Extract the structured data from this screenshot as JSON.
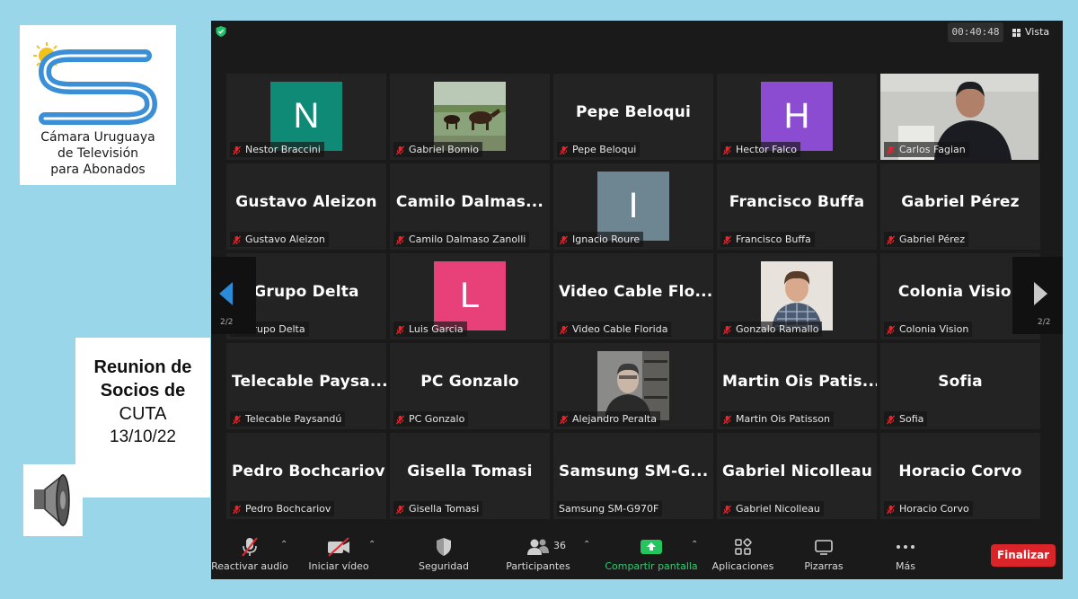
{
  "logo": {
    "line1": "Cámara Uruguaya",
    "line2": "de Televisión",
    "line3": "para Abonados",
    "colors": {
      "wave": "#3a8fd6",
      "sun": "#f2c21b"
    }
  },
  "note": {
    "line1": "Reunion de",
    "line2": "Socios de",
    "line3": "CUTA",
    "date": "13/10/22"
  },
  "zoom": {
    "timer": "00:40:48",
    "view_label": "Vista",
    "page_indicator_left": "2/2",
    "page_indicator_right": "2/2",
    "participants": [
      {
        "name": "Nestor Braccini",
        "big": "",
        "avatar_letter": "N",
        "avatar_color": "#0e8a76",
        "video": false
      },
      {
        "name": "Gabriel Bomio",
        "big": "",
        "avatar_letter": "",
        "avatar_color": "",
        "video": "horses"
      },
      {
        "name": "Pepe Beloqui",
        "big": "Pepe Beloqui",
        "avatar_letter": "",
        "avatar_color": "",
        "video": false
      },
      {
        "name": "Hector Falco",
        "big": "",
        "avatar_letter": "H",
        "avatar_color": "#8b4cd1",
        "video": false
      },
      {
        "name": "Carlos Fagian",
        "big": "",
        "avatar_letter": "",
        "avatar_color": "",
        "video": "man-room"
      },
      {
        "name": "Gustavo Aleizon",
        "big": "Gustavo Aleizon",
        "avatar_letter": "",
        "avatar_color": "",
        "video": false
      },
      {
        "name": "Camilo Dalmaso Zanolli",
        "big": "Camilo  Dalmas...",
        "avatar_letter": "",
        "avatar_color": "",
        "video": false
      },
      {
        "name": "Ignacio Roure",
        "big": "",
        "avatar_letter": "I",
        "avatar_color": "#6e8592",
        "video": false
      },
      {
        "name": "Francisco Buffa",
        "big": "Francisco Buffa",
        "avatar_letter": "",
        "avatar_color": "",
        "video": false
      },
      {
        "name": "Gabriel Pérez",
        "big": "Gabriel Pérez",
        "avatar_letter": "",
        "avatar_color": "",
        "video": false
      },
      {
        "name": "Grupo Delta",
        "big": "Grupo Delta",
        "avatar_letter": "",
        "avatar_color": "",
        "video": false
      },
      {
        "name": "Luis Garcia",
        "big": "",
        "avatar_letter": "L",
        "avatar_color": "#e84078",
        "video": false
      },
      {
        "name": "Video Cable Florida",
        "big": "Video  Cable  Flo...",
        "avatar_letter": "",
        "avatar_color": "",
        "video": false
      },
      {
        "name": "Gonzalo Ramallo",
        "big": "",
        "avatar_letter": "",
        "avatar_color": "",
        "video": "young-man"
      },
      {
        "name": "Colonia Vision",
        "big": "Colonia Vision",
        "avatar_letter": "",
        "avatar_color": "",
        "video": false
      },
      {
        "name": "Telecable Paysandú",
        "big": "Telecable  Paysa...",
        "avatar_letter": "",
        "avatar_color": "",
        "video": false
      },
      {
        "name": "PC Gonzalo",
        "big": "PC Gonzalo",
        "avatar_letter": "",
        "avatar_color": "",
        "video": false
      },
      {
        "name": "Alejandro Peralta",
        "big": "",
        "avatar_letter": "",
        "avatar_color": "",
        "video": "man-shelves"
      },
      {
        "name": "Martin Ois Patisson",
        "big": "Martin  Ois  Patis...",
        "avatar_letter": "",
        "avatar_color": "",
        "video": false
      },
      {
        "name": "Sofia",
        "big": "Sofia",
        "avatar_letter": "",
        "avatar_color": "",
        "video": false
      },
      {
        "name": "Pedro Bochcariov",
        "big": "Pedro Bochcariov",
        "avatar_letter": "",
        "avatar_color": "",
        "video": false
      },
      {
        "name": "Gisella Tomasi",
        "big": "Gisella Tomasi",
        "avatar_letter": "",
        "avatar_color": "",
        "video": false
      },
      {
        "name": "Samsung SM-G970F",
        "big": "Samsung  SM-G...",
        "avatar_letter": "",
        "avatar_color": "",
        "video": false,
        "label_override": "Samsung SM-G970F",
        "mic_icon": false
      },
      {
        "name": "Gabriel Nicolleau",
        "big": "Gabriel Nicolleau",
        "avatar_letter": "",
        "avatar_color": "",
        "video": false
      },
      {
        "name": "Horacio Corvo",
        "big": "Horacio Corvo",
        "avatar_letter": "",
        "avatar_color": "",
        "video": false
      }
    ],
    "toolbar": {
      "unmute": "Reactivar audio",
      "start_video": "Iniciar vídeo",
      "security": "Seguridad",
      "participants": "Participantes",
      "participants_count": "36",
      "share": "Compartir pantalla",
      "apps": "Aplicaciones",
      "whiteboards": "Pizarras",
      "more": "Más",
      "end": "Finalizar"
    }
  }
}
